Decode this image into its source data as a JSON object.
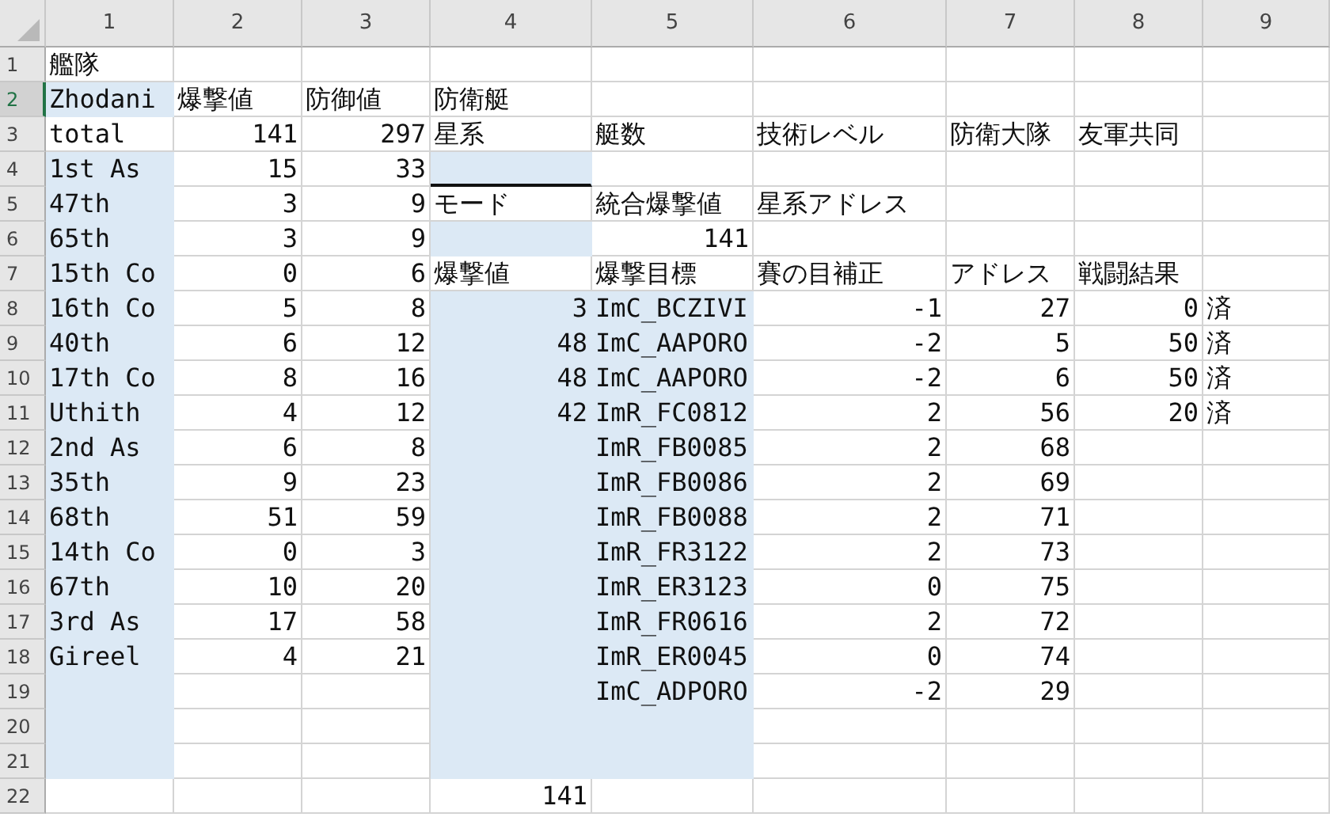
{
  "columns": [
    "1",
    "2",
    "3",
    "4",
    "5",
    "6",
    "7",
    "8",
    "9"
  ],
  "rows": [
    {
      "label": "1",
      "selected": false,
      "cells": [
        {
          "text": "艦隊",
          "kind": "text",
          "shaded": false
        }
      ]
    },
    {
      "label": "2",
      "selected": true,
      "cells": [
        {
          "text": "Zhodani",
          "kind": "text",
          "shaded": true
        },
        {
          "text": "爆撃値",
          "kind": "text",
          "shaded": false
        },
        {
          "text": "防御値",
          "kind": "text",
          "shaded": false
        },
        {
          "text": "防衛艇",
          "kind": "text",
          "shaded": false
        }
      ]
    },
    {
      "label": "3",
      "selected": false,
      "cells": [
        {
          "text": "total",
          "kind": "text",
          "shaded": false
        },
        {
          "text": "141",
          "kind": "number",
          "shaded": false
        },
        {
          "text": "297",
          "kind": "number",
          "shaded": false
        },
        {
          "text": "星系",
          "kind": "text",
          "shaded": false
        },
        {
          "text": "艇数",
          "kind": "text",
          "shaded": false
        },
        {
          "text": "技術レベル",
          "kind": "text",
          "shaded": false
        },
        {
          "text": "防衛大隊",
          "kind": "text",
          "shaded": false
        },
        {
          "text": "友軍共同",
          "kind": "text",
          "shaded": false
        }
      ]
    },
    {
      "label": "4",
      "selected": false,
      "cells": [
        {
          "text": "1st As",
          "kind": "text",
          "shaded": true
        },
        {
          "text": "15",
          "kind": "number",
          "shaded": false
        },
        {
          "text": "33",
          "kind": "number",
          "shaded": false
        },
        {
          "shaded": true,
          "bottom_border": true
        }
      ]
    },
    {
      "label": "5",
      "selected": false,
      "cells": [
        {
          "text": "47th",
          "kind": "text",
          "shaded": true
        },
        {
          "text": "3",
          "kind": "number",
          "shaded": false
        },
        {
          "text": "9",
          "kind": "number",
          "shaded": false
        },
        {
          "text": "モード",
          "kind": "text",
          "shaded": false
        },
        {
          "text": "統合爆撃値",
          "kind": "text",
          "shaded": false
        },
        {
          "text": "星系アドレス",
          "kind": "text",
          "shaded": false
        }
      ]
    },
    {
      "label": "6",
      "selected": false,
      "cells": [
        {
          "text": "65th",
          "kind": "text",
          "shaded": true
        },
        {
          "text": "3",
          "kind": "number",
          "shaded": false
        },
        {
          "text": "9",
          "kind": "number",
          "shaded": false
        },
        {
          "shaded": true
        },
        {
          "text": "141",
          "kind": "number",
          "shaded": false
        }
      ]
    },
    {
      "label": "7",
      "selected": false,
      "cells": [
        {
          "text": "15th Co",
          "kind": "text",
          "shaded": true
        },
        {
          "text": "0",
          "kind": "number",
          "shaded": false
        },
        {
          "text": "6",
          "kind": "number",
          "shaded": false
        },
        {
          "text": "爆撃値",
          "kind": "text",
          "shaded": false
        },
        {
          "text": "爆撃目標",
          "kind": "text",
          "shaded": false
        },
        {
          "text": "賽の目補正",
          "kind": "text",
          "shaded": false
        },
        {
          "text": "アドレス",
          "kind": "text",
          "shaded": false
        },
        {
          "text": "戦闘結果",
          "kind": "text",
          "shaded": false
        }
      ]
    },
    {
      "label": "8",
      "selected": false,
      "cells": [
        {
          "text": "16th Co",
          "kind": "text",
          "shaded": true
        },
        {
          "text": "5",
          "kind": "number",
          "shaded": false
        },
        {
          "text": "8",
          "kind": "number",
          "shaded": false
        },
        {
          "text": "3",
          "kind": "number",
          "shaded": true
        },
        {
          "text": "ImC_BCZIVI",
          "kind": "text",
          "shaded": true
        },
        {
          "text": "-1",
          "kind": "number",
          "shaded": false
        },
        {
          "text": "27",
          "kind": "number",
          "shaded": false
        },
        {
          "text": "0",
          "kind": "number",
          "shaded": false
        },
        {
          "text": "済",
          "kind": "text",
          "shaded": false
        }
      ]
    },
    {
      "label": "9",
      "selected": false,
      "cells": [
        {
          "text": "40th",
          "kind": "text",
          "shaded": true
        },
        {
          "text": "6",
          "kind": "number",
          "shaded": false
        },
        {
          "text": "12",
          "kind": "number",
          "shaded": false
        },
        {
          "text": "48",
          "kind": "number",
          "shaded": true
        },
        {
          "text": "ImC_AAPORO",
          "kind": "text",
          "shaded": true
        },
        {
          "text": "-2",
          "kind": "number",
          "shaded": false
        },
        {
          "text": "5",
          "kind": "number",
          "shaded": false
        },
        {
          "text": "50",
          "kind": "number",
          "shaded": false
        },
        {
          "text": "済",
          "kind": "text",
          "shaded": false
        }
      ]
    },
    {
      "label": "10",
      "selected": false,
      "cells": [
        {
          "text": "17th Co",
          "kind": "text",
          "shaded": true
        },
        {
          "text": "8",
          "kind": "number",
          "shaded": false
        },
        {
          "text": "16",
          "kind": "number",
          "shaded": false
        },
        {
          "text": "48",
          "kind": "number",
          "shaded": true
        },
        {
          "text": "ImC_AAPORO",
          "kind": "text",
          "shaded": true
        },
        {
          "text": "-2",
          "kind": "number",
          "shaded": false
        },
        {
          "text": "6",
          "kind": "number",
          "shaded": false
        },
        {
          "text": "50",
          "kind": "number",
          "shaded": false
        },
        {
          "text": "済",
          "kind": "text",
          "shaded": false
        }
      ]
    },
    {
      "label": "11",
      "selected": false,
      "cells": [
        {
          "text": "Uthith",
          "kind": "text",
          "shaded": true
        },
        {
          "text": "4",
          "kind": "number",
          "shaded": false
        },
        {
          "text": "12",
          "kind": "number",
          "shaded": false
        },
        {
          "text": "42",
          "kind": "number",
          "shaded": true
        },
        {
          "text": "ImR_FC0812",
          "kind": "text",
          "shaded": true
        },
        {
          "text": "2",
          "kind": "number",
          "shaded": false
        },
        {
          "text": "56",
          "kind": "number",
          "shaded": false
        },
        {
          "text": "20",
          "kind": "number",
          "shaded": false
        },
        {
          "text": "済",
          "kind": "text",
          "shaded": false
        }
      ]
    },
    {
      "label": "12",
      "selected": false,
      "cells": [
        {
          "text": "2nd As",
          "kind": "text",
          "shaded": true
        },
        {
          "text": "6",
          "kind": "number",
          "shaded": false
        },
        {
          "text": "8",
          "kind": "number",
          "shaded": false
        },
        {
          "shaded": true
        },
        {
          "text": "ImR_FB0085",
          "kind": "text",
          "shaded": true
        },
        {
          "text": "2",
          "kind": "number",
          "shaded": false
        },
        {
          "text": "68",
          "kind": "number",
          "shaded": false
        }
      ]
    },
    {
      "label": "13",
      "selected": false,
      "cells": [
        {
          "text": "35th",
          "kind": "text",
          "shaded": true
        },
        {
          "text": "9",
          "kind": "number",
          "shaded": false
        },
        {
          "text": "23",
          "kind": "number",
          "shaded": false
        },
        {
          "shaded": true
        },
        {
          "text": "ImR_FB0086",
          "kind": "text",
          "shaded": true
        },
        {
          "text": "2",
          "kind": "number",
          "shaded": false
        },
        {
          "text": "69",
          "kind": "number",
          "shaded": false
        }
      ]
    },
    {
      "label": "14",
      "selected": false,
      "cells": [
        {
          "text": "68th",
          "kind": "text",
          "shaded": true
        },
        {
          "text": "51",
          "kind": "number",
          "shaded": false
        },
        {
          "text": "59",
          "kind": "number",
          "shaded": false
        },
        {
          "shaded": true
        },
        {
          "text": "ImR_FB0088",
          "kind": "text",
          "shaded": true
        },
        {
          "text": "2",
          "kind": "number",
          "shaded": false
        },
        {
          "text": "71",
          "kind": "number",
          "shaded": false
        }
      ]
    },
    {
      "label": "15",
      "selected": false,
      "cells": [
        {
          "text": "14th Co",
          "kind": "text",
          "shaded": true
        },
        {
          "text": "0",
          "kind": "number",
          "shaded": false
        },
        {
          "text": "3",
          "kind": "number",
          "shaded": false
        },
        {
          "shaded": true
        },
        {
          "text": "ImR_FR3122",
          "kind": "text",
          "shaded": true
        },
        {
          "text": "2",
          "kind": "number",
          "shaded": false
        },
        {
          "text": "73",
          "kind": "number",
          "shaded": false
        }
      ]
    },
    {
      "label": "16",
      "selected": false,
      "cells": [
        {
          "text": "67th",
          "kind": "text",
          "shaded": true
        },
        {
          "text": "10",
          "kind": "number",
          "shaded": false
        },
        {
          "text": "20",
          "kind": "number",
          "shaded": false
        },
        {
          "shaded": true
        },
        {
          "text": "ImR_ER3123",
          "kind": "text",
          "shaded": true
        },
        {
          "text": "0",
          "kind": "number",
          "shaded": false
        },
        {
          "text": "75",
          "kind": "number",
          "shaded": false
        }
      ]
    },
    {
      "label": "17",
      "selected": false,
      "cells": [
        {
          "text": "3rd As",
          "kind": "text",
          "shaded": true
        },
        {
          "text": "17",
          "kind": "number",
          "shaded": false
        },
        {
          "text": "58",
          "kind": "number",
          "shaded": false
        },
        {
          "shaded": true
        },
        {
          "text": "ImR_FR0616",
          "kind": "text",
          "shaded": true
        },
        {
          "text": "2",
          "kind": "number",
          "shaded": false
        },
        {
          "text": "72",
          "kind": "number",
          "shaded": false
        }
      ]
    },
    {
      "label": "18",
      "selected": false,
      "cells": [
        {
          "text": "Gireel",
          "kind": "text",
          "shaded": true
        },
        {
          "text": "4",
          "kind": "number",
          "shaded": false
        },
        {
          "text": "21",
          "kind": "number",
          "shaded": false
        },
        {
          "shaded": true
        },
        {
          "text": "ImR_ER0045",
          "kind": "text",
          "shaded": true
        },
        {
          "text": "0",
          "kind": "number",
          "shaded": false
        },
        {
          "text": "74",
          "kind": "number",
          "shaded": false
        }
      ]
    },
    {
      "label": "19",
      "selected": false,
      "cells": [
        {
          "shaded": true
        },
        {
          "shaded": false
        },
        {
          "shaded": false
        },
        {
          "shaded": true
        },
        {
          "text": "ImC_ADPORO",
          "kind": "text",
          "shaded": true
        },
        {
          "text": "-2",
          "kind": "number",
          "shaded": false
        },
        {
          "text": "29",
          "kind": "number",
          "shaded": false
        }
      ]
    },
    {
      "label": "20",
      "selected": false,
      "cells": [
        {
          "shaded": true
        },
        {
          "shaded": false
        },
        {
          "shaded": false
        },
        {
          "shaded": true
        },
        {
          "shaded": true
        }
      ]
    },
    {
      "label": "21",
      "selected": false,
      "cells": [
        {
          "shaded": true
        },
        {
          "shaded": false
        },
        {
          "shaded": false
        },
        {
          "shaded": true
        },
        {
          "shaded": true
        }
      ]
    },
    {
      "label": "22",
      "selected": false,
      "cells": [
        {
          "shaded": false
        },
        {
          "shaded": false
        },
        {
          "shaded": false
        },
        {
          "text": "141",
          "kind": "number",
          "shaded": false
        }
      ]
    }
  ]
}
